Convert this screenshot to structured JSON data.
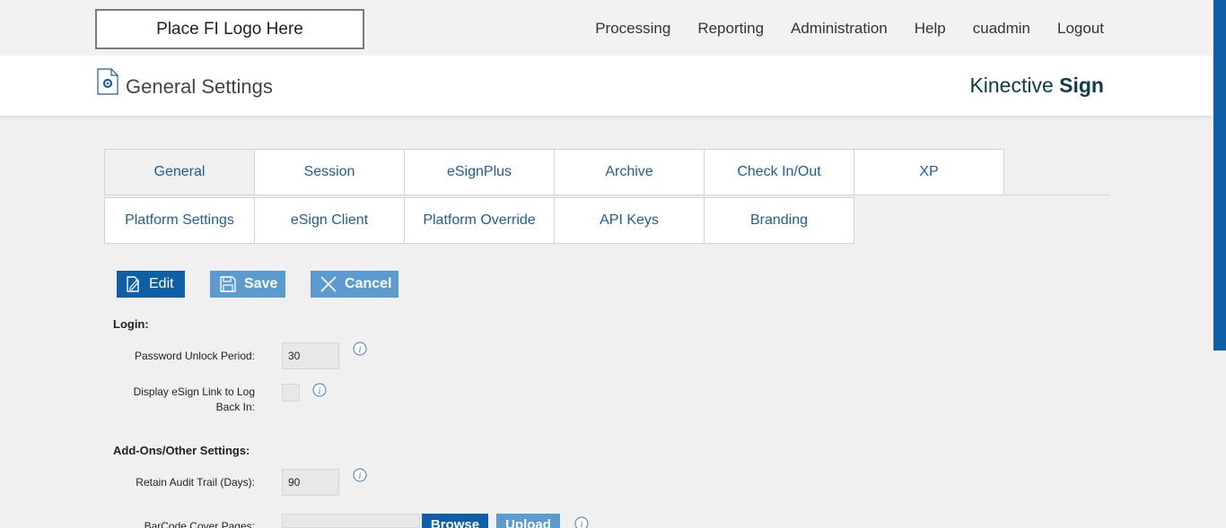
{
  "header": {
    "logo_text": "Place FI Logo Here",
    "nav": [
      "Processing",
      "Reporting",
      "Administration",
      "Help",
      "cuadmin",
      "Logout"
    ]
  },
  "titlebar": {
    "title": "General Settings",
    "brand_light": "Kinective",
    "brand_bold": "Sign"
  },
  "tabs": {
    "row1": [
      "General",
      "Session",
      "eSignPlus",
      "Archive",
      "Check In/Out",
      "XP"
    ],
    "row2": [
      "Platform Settings",
      "eSign Client",
      "Platform Override",
      "API Keys",
      "Branding"
    ],
    "active": "General"
  },
  "toolbar": {
    "edit_label": "Edit",
    "save_label": "Save",
    "cancel_label": "Cancel"
  },
  "form": {
    "login_section": "Login:",
    "password_unlock_label": "Password Unlock Period:",
    "password_unlock_value": "30",
    "display_link_label_1": "Display eSign Link to Log",
    "display_link_label_2": "Back In:",
    "addons_section": "Add-Ons/Other Settings:",
    "retain_audit_label": "Retain Audit Trail (Days):",
    "retain_audit_value": "90",
    "barcode_label": "BarCode Cover Pages:",
    "browse_label": "Browse",
    "upload_label": "Upload"
  },
  "colors": {
    "primary": "#0e5fa6",
    "disabled_button": "#5b9bd0",
    "tab_text": "#1c5f95",
    "brand": "#0d3b47"
  }
}
